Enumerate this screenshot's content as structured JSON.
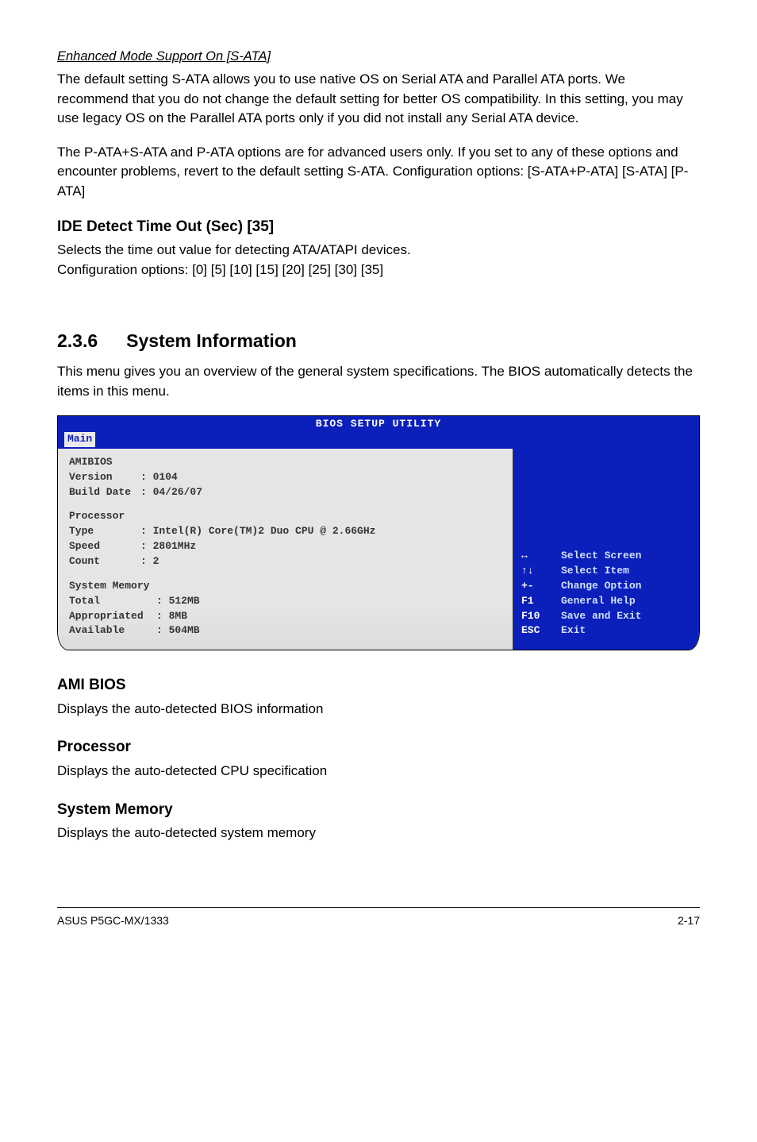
{
  "enhanced_mode": {
    "heading": "Enhanced Mode Support On [S-ATA]",
    "para1": "The default setting S-ATA allows you to use native OS on Serial ATA and Parallel ATA ports. We recommend that you do not change the default setting for better OS compatibility. In this setting, you may use legacy OS on the Parallel ATA ports only if you did not install any Serial ATA device.",
    "para2": "The P-ATA+S-ATA and P-ATA options are for advanced users only. If you set to any of these options and encounter problems, revert to the default setting S-ATA. Configuration options: [S-ATA+P-ATA] [S-ATA] [P-ATA]"
  },
  "ide_detect": {
    "heading": "IDE Detect Time Out (Sec) [35]",
    "line1": "Selects the time out value for detecting ATA/ATAPI devices.",
    "line2": "Configuration options: [0] [5] [10] [15] [20] [25] [30] [35]"
  },
  "section236": {
    "num": "2.3.6",
    "title": "System Information",
    "intro": "This menu gives you an overview of the general system specifications. The BIOS automatically detects the items in this menu."
  },
  "bios": {
    "title": "BIOS SETUP UTILITY",
    "tab": "Main",
    "amibios_label": "AMIBIOS",
    "version_label": "Version",
    "version_value": ": 0104",
    "build_label": "Build Date",
    "build_value": ": 04/26/07",
    "processor_label": "Processor",
    "type_label": "Type",
    "type_value": ": Intel(R) Core(TM)2 Duo CPU @ 2.66GHz",
    "speed_label": "Speed",
    "speed_value": ": 2801MHz",
    "count_label": "Count",
    "count_value": ": 2",
    "sysmem_label": "System Memory",
    "total_label": "Total",
    "total_value": ": 512MB",
    "approp_label": "Appropriated",
    "approp_value": ": 8MB",
    "avail_label": "Available",
    "avail_value": ": 504MB",
    "help": [
      {
        "key": "↔",
        "text": "Select Screen"
      },
      {
        "key": "↑↓",
        "text": "Select Item"
      },
      {
        "key": "+-",
        "text": "Change Option"
      },
      {
        "key": "F1",
        "text": "General Help"
      },
      {
        "key": "F10",
        "text": "Save and Exit"
      },
      {
        "key": "ESC",
        "text": "Exit"
      }
    ]
  },
  "ami_bios": {
    "heading": "AMI BIOS",
    "text": "Displays the auto-detected BIOS information"
  },
  "processor": {
    "heading": "Processor",
    "text": "Displays the auto-detected CPU specification"
  },
  "system_memory": {
    "heading": "System Memory",
    "text": "Displays the auto-detected system memory"
  },
  "footer": {
    "left": "ASUS P5GC-MX/1333",
    "right": "2-17"
  }
}
